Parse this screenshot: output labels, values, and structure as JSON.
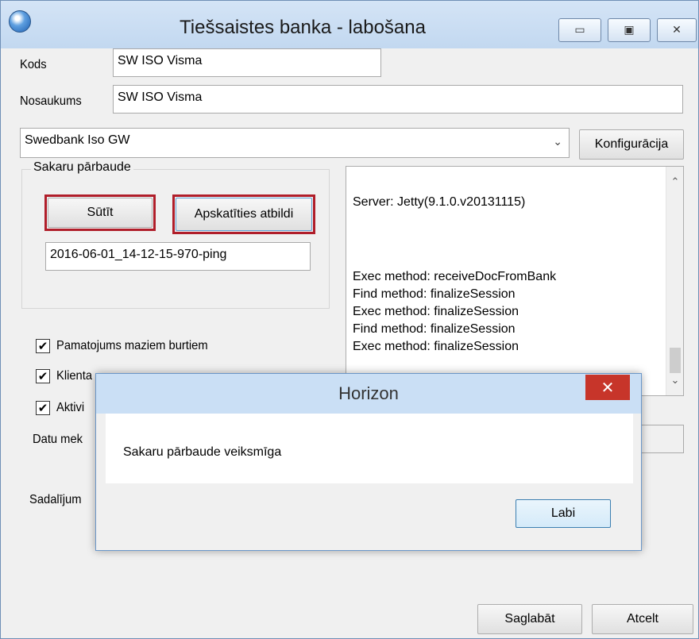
{
  "window": {
    "title": "Tiešsaistes banka - labošana",
    "controls": {
      "minimize": "▭",
      "maximize": "▣",
      "close": "✕"
    }
  },
  "form": {
    "kods_label": "Kods",
    "kods_value": "SW ISO Visma",
    "nosaukums_label": "Nosaukums",
    "nosaukums_value": "SW ISO Visma",
    "bank_select": "Swedbank Iso GW",
    "config_button": "Konfigurācija"
  },
  "connection_test": {
    "group_title": "Sakaru pārbaude",
    "send_button": "Sūtīt",
    "view_response_button": "Apskatīties atbildi",
    "response_file": "2016-06-01_14-12-15-970-ping"
  },
  "log": {
    "lines": [
      "Server: Jetty(9.1.0.v20131115)",
      "Exec method: receiveDocFromBank",
      "Find method: finalizeSession",
      "Exec method: finalizeSession",
      "Find method: finalizeSession",
      "Exec method: finalizeSession"
    ]
  },
  "options": {
    "lowercase_label": "Pamatojums maziem burtiem",
    "client_label_partial": "Klienta",
    "active_label_partial": "Aktivi",
    "check_glyph": "✔"
  },
  "labels": {
    "data_partial": "Datu mek",
    "split_partial": "Sadalījum"
  },
  "footer": {
    "save_button": "Saglabāt",
    "cancel_button": "Atcelt"
  },
  "dialog": {
    "title": "Horizon",
    "message": "Sakaru pārbaude veiksmīga",
    "ok_button": "Labi",
    "close_glyph": "✕"
  },
  "colors": {
    "highlight": "#b01e2a",
    "dialog_close": "#c7352a",
    "titlebar": "#cadff5"
  }
}
